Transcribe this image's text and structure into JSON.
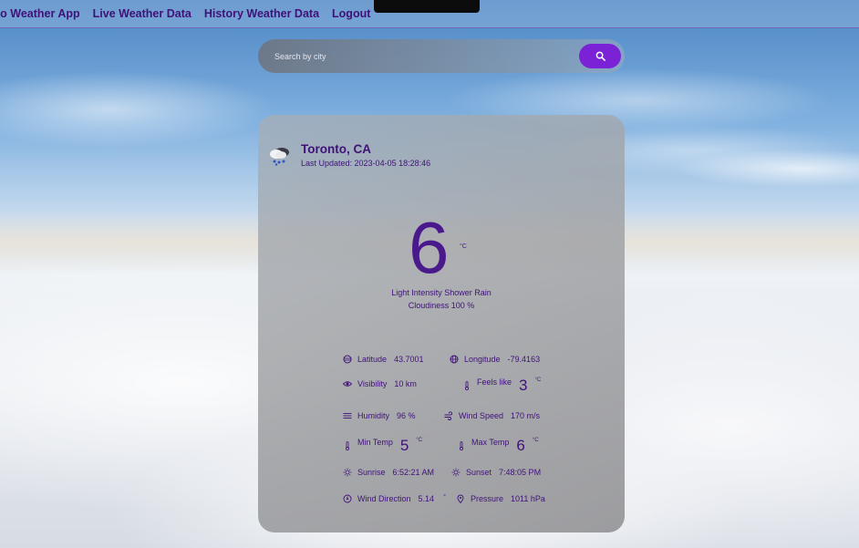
{
  "nav": {
    "items": [
      "to Weather App",
      "Live Weather Data",
      "History Weather Data",
      "Logout"
    ]
  },
  "search": {
    "placeholder": "Search by city",
    "button_icon": "search-icon"
  },
  "weather": {
    "city": "Toronto, CA",
    "last_updated": "Last Updated: 2023-04-05 18:28:46",
    "temperature": "6",
    "temperature_unit": "°C",
    "description": "Light Intensity Shower Rain",
    "cloudiness": "Cloudiness 100 %",
    "condition_icon": "rain-cloud-icon"
  },
  "stats": {
    "latitude": {
      "label": "Latitude",
      "value": "43.7001",
      "icon": "latitude-icon"
    },
    "longitude": {
      "label": "Longitude",
      "value": "-79.4163",
      "icon": "globe-icon"
    },
    "visibility": {
      "label": "Visibility",
      "value": "10 km",
      "icon": "eye-icon"
    },
    "feels_like": {
      "label": "Feels like",
      "value": "3",
      "unit": "°C",
      "icon": "thermometer-icon"
    },
    "humidity": {
      "label": "Humidity",
      "value": "96 %",
      "icon": "humidity-icon"
    },
    "wind_speed": {
      "label": "Wind Speed",
      "value": "170 m/s",
      "icon": "wind-icon"
    },
    "min_temp": {
      "label": "Min Temp",
      "value": "5",
      "unit": "°C",
      "icon": "thermometer-icon"
    },
    "max_temp": {
      "label": "Max Temp",
      "value": "6",
      "unit": "°C",
      "icon": "thermometer-icon"
    },
    "sunrise": {
      "label": "Sunrise",
      "value": "6:52:21 AM",
      "icon": "sun-icon"
    },
    "sunset": {
      "label": "Sunset",
      "value": "7:48:05 PM",
      "icon": "sun-icon"
    },
    "wind_direction": {
      "label": "Wind Direction",
      "value": "5.14",
      "unit": "°",
      "icon": "compass-icon"
    },
    "pressure": {
      "label": "Pressure",
      "value": "1011 hPa",
      "icon": "pressure-pin-icon"
    }
  },
  "colors": {
    "accent": "#7b22d6",
    "text": "#3f1278"
  }
}
